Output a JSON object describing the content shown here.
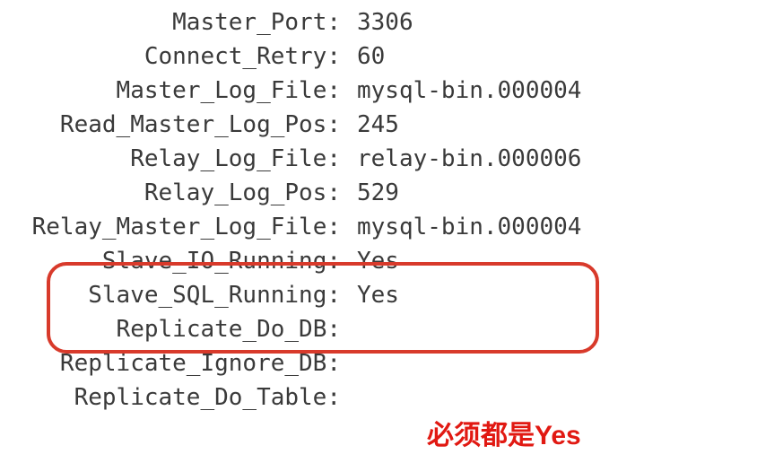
{
  "status": {
    "rows": [
      {
        "label": "Master_Port:",
        "value": "3306"
      },
      {
        "label": "Connect_Retry:",
        "value": "60"
      },
      {
        "label": "Master_Log_File:",
        "value": "mysql-bin.000004"
      },
      {
        "label": "Read_Master_Log_Pos:",
        "value": "245"
      },
      {
        "label": "Relay_Log_File:",
        "value": "relay-bin.000006"
      },
      {
        "label": "Relay_Log_Pos:",
        "value": "529"
      },
      {
        "label": "Relay_Master_Log_File:",
        "value": "mysql-bin.000004"
      },
      {
        "label": "Slave_IO_Running:",
        "value": "Yes"
      },
      {
        "label": "Slave_SQL_Running:",
        "value": "Yes"
      },
      {
        "label": "Replicate_Do_DB:",
        "value": ""
      },
      {
        "label": "Replicate_Ignore_DB:",
        "value": ""
      },
      {
        "label": "Replicate_Do_Table:",
        "value": ""
      }
    ]
  },
  "annotation": {
    "note": "必须都是Yes"
  }
}
